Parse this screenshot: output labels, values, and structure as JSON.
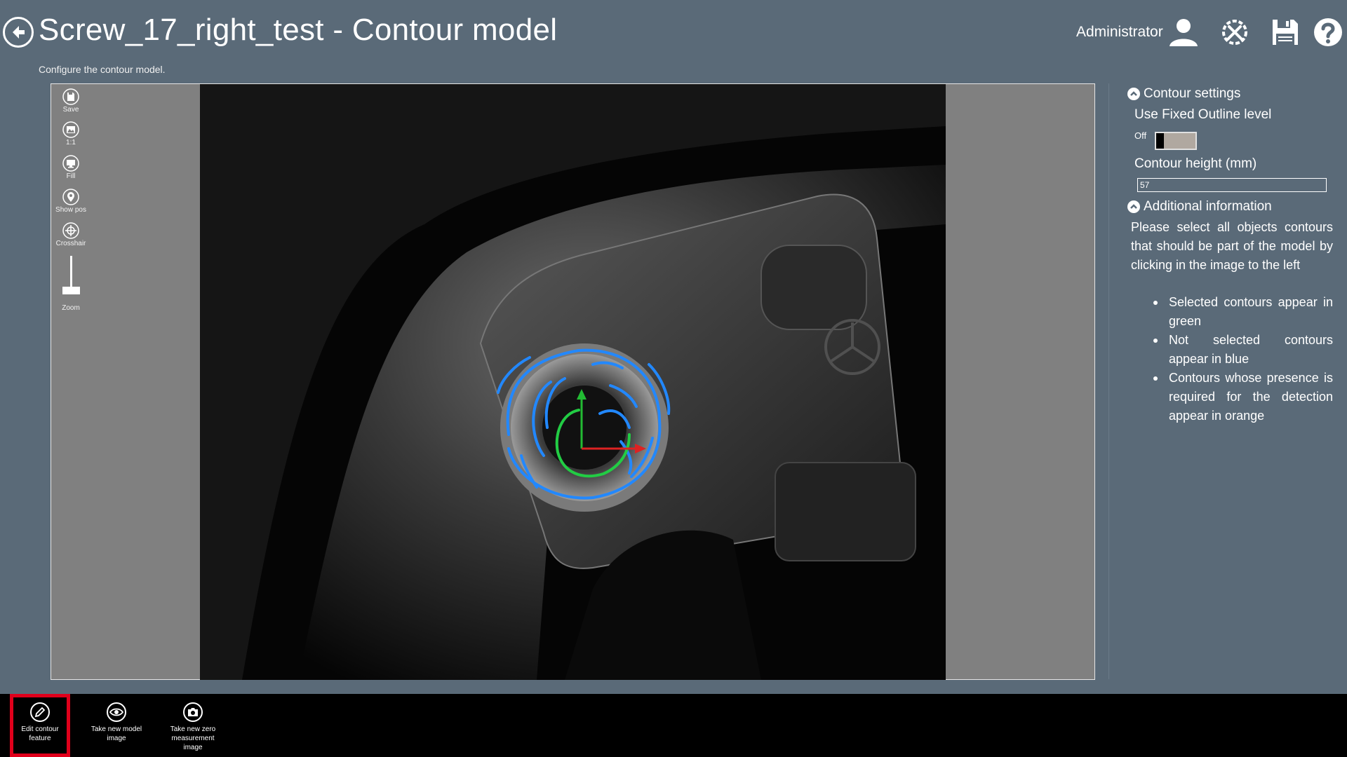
{
  "header": {
    "title": "Screw_17_right_test - Contour model",
    "subtitle": "Configure the contour model.",
    "user": "Administrator"
  },
  "toolbar": {
    "save_label": "Save",
    "one_to_one_label": "1:1",
    "fill_label": "Fill",
    "show_pos_label": "Show pos",
    "crosshair_label": "Crosshair",
    "zoom_label": "Zoom",
    "zoom_level": 0.2
  },
  "settings": {
    "contour_settings_title": "Contour settings",
    "fixed_outline_label": "Use Fixed Outline level",
    "toggle_state": "Off",
    "contour_height_label": "Contour height (mm)",
    "contour_height_value": "57"
  },
  "info": {
    "title": "Additional information",
    "text": "Please select all objects contours that should be part of the model by clicking in the image to the left",
    "bullets": [
      "Selected contours appear in green",
      "Not selected contours appear in blue",
      "Contours whose presence is required for the detection appear in orange"
    ]
  },
  "bottom": {
    "edit_label": "Edit contour feature",
    "take_model_label": "Take new model image",
    "take_zero_label": "Take new zero measurement image"
  },
  "colors": {
    "selected_contour": "#22cc44",
    "unselected_contour": "#2288ff",
    "active_highlight": "#e0001b"
  }
}
